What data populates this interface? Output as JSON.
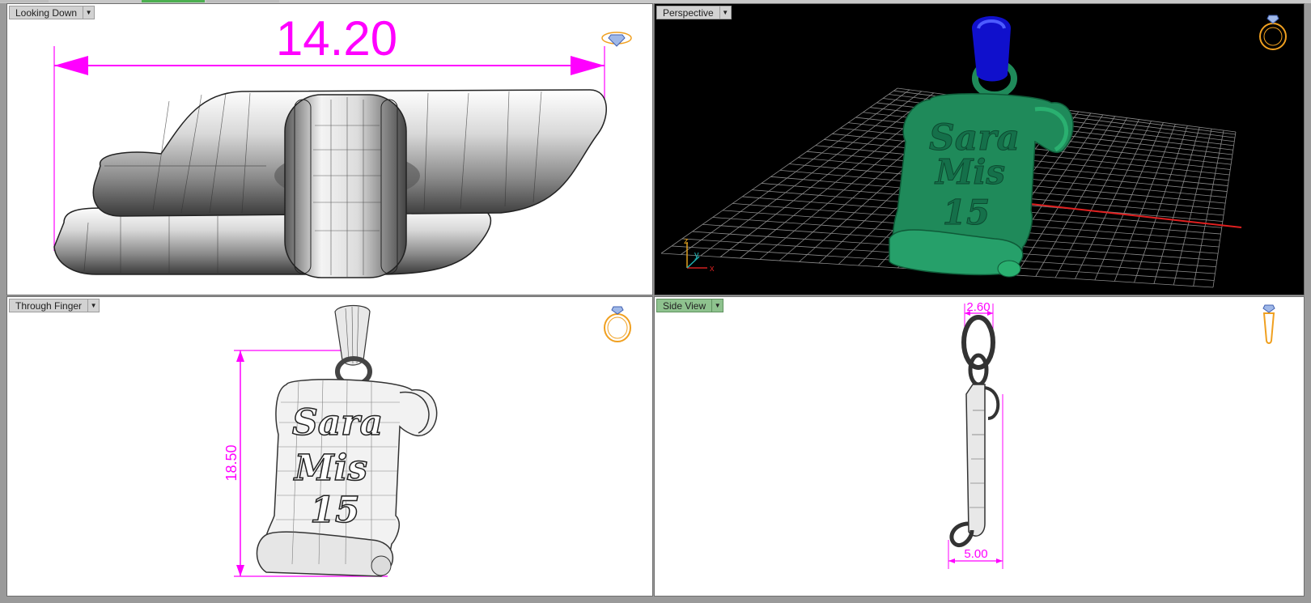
{
  "viewports": {
    "top_left": {
      "label": "Looking Down",
      "dimension": "14.20",
      "active": false
    },
    "top_right": {
      "label": "Perspective",
      "active": false,
      "engraving": [
        "Sara",
        "Mis",
        "15"
      ],
      "axes": {
        "z": "z",
        "y": "y",
        "x": "x"
      }
    },
    "bottom_left": {
      "label": "Through Finger",
      "dimension": "18.50",
      "active": false,
      "engraving": [
        "Sara",
        "Mis",
        "15"
      ]
    },
    "bottom_right": {
      "label": "Side View",
      "active": true,
      "dimension_top": "2.60",
      "dimension_bottom": "5.00"
    }
  },
  "icons": {
    "top_left": "ring-top-view-icon",
    "top_right": "ring-perspective-icon",
    "bottom_left": "ring-front-view-icon",
    "bottom_right": "ring-side-view-icon"
  },
  "colors": {
    "dimension": "#ff00ff",
    "pendant_green": "#1f8a5a",
    "bail_blue": "#1010cc",
    "ring_gold": "#f0a020",
    "active_tab": "#8ec28e"
  }
}
